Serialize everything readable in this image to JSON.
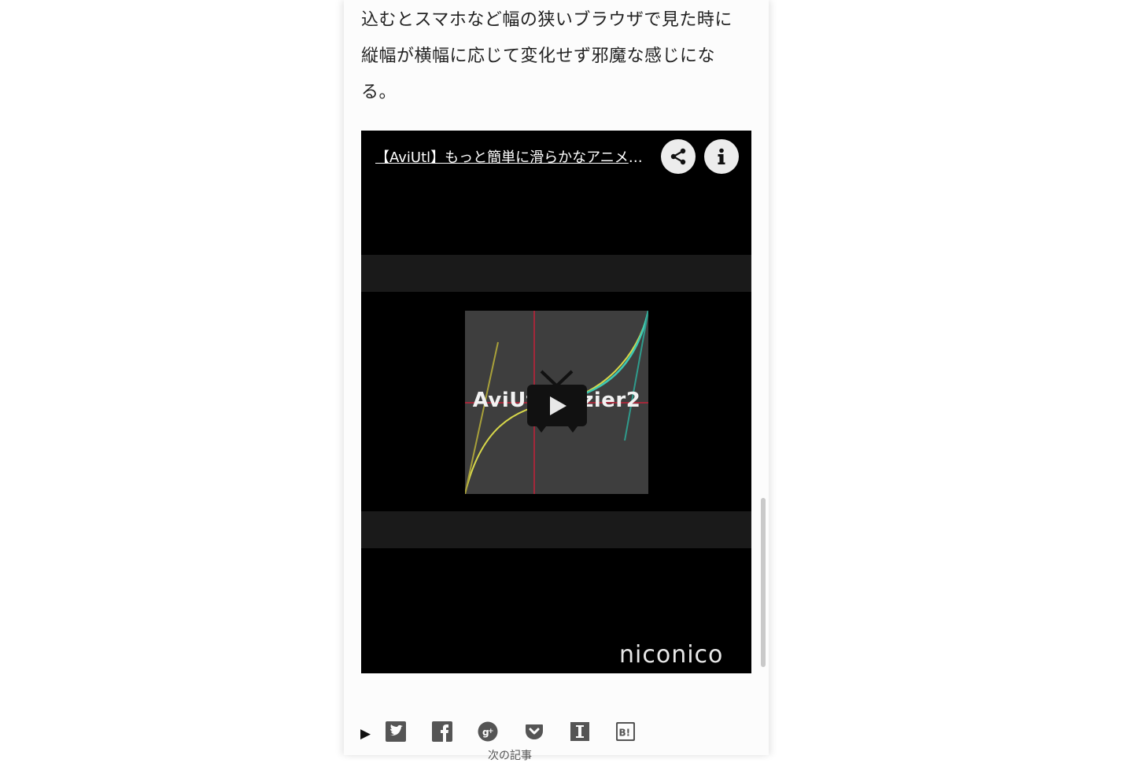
{
  "article": {
    "paragraph_lines": [
      "込むとスマホなど幅の狭いブラウザで見た時に",
      "縦幅が横幅に応じて変化せず邪魔な感じにな",
      "る。"
    ]
  },
  "player": {
    "title": "【AviUtl】もっと簡単に滑らかなアニメーション",
    "thumbnail_text": "AviUtl Bezier2",
    "brand": "niconico"
  },
  "share": {
    "toggle_glyph": "▶",
    "icons": [
      "twitter-icon",
      "facebook-icon",
      "google-plus-icon",
      "pocket-icon",
      "instapaper-icon",
      "hatena-bookmark-icon"
    ]
  },
  "footer": {
    "partial_label": "次の記事"
  }
}
